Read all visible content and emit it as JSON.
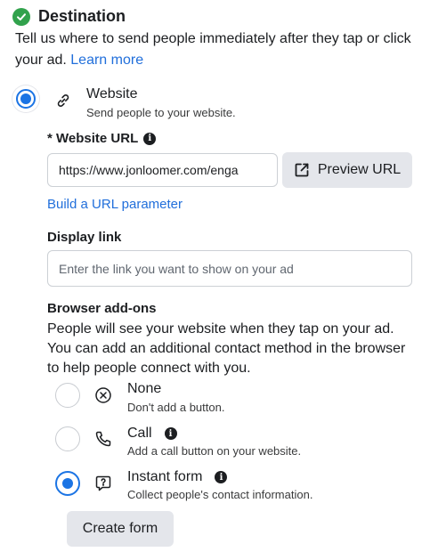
{
  "header": {
    "title": "Destination"
  },
  "intro": {
    "text": "Tell us where to send people immediately after they tap or click your ad. ",
    "learn_more": "Learn more"
  },
  "website_option": {
    "title": "Website",
    "subtitle": "Send people to your website."
  },
  "website_url": {
    "label": "* Website URL",
    "value": "https://www.jonloomer.com/enga",
    "preview_button": "Preview URL",
    "build_param_link": "Build a URL parameter"
  },
  "display_link": {
    "label": "Display link",
    "placeholder": "Enter the link you want to show on your ad"
  },
  "browser_addons": {
    "label": "Browser add-ons",
    "description": "People will see your website when they tap on your ad. You can add an additional contact method in the browser to help people connect with you.",
    "options": [
      {
        "title": "None",
        "subtitle": "Don't add a button.",
        "selected": false,
        "icon": "close-circle-icon"
      },
      {
        "title": "Call",
        "subtitle": "Add a call button on your website.",
        "selected": false,
        "icon": "phone-icon"
      },
      {
        "title": "Instant form",
        "subtitle": "Collect people's contact information.",
        "selected": true,
        "icon": "question-bubble-icon"
      }
    ],
    "create_form_button": "Create form"
  },
  "colors": {
    "accent": "#1b74e4",
    "link": "#216fdb",
    "success": "#31a24c",
    "button_bg": "#e4e6eb"
  }
}
